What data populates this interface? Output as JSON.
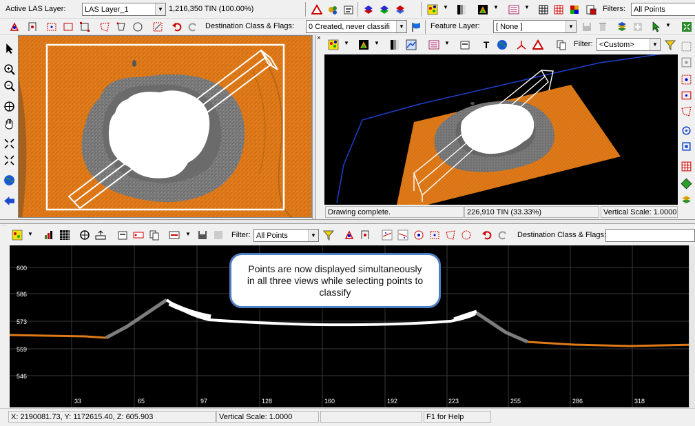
{
  "toolbar1": {
    "active_las_label": "Active LAS Layer:",
    "active_las_value": "LAS Layer_1",
    "tin_count": "1,216,350 TIN (100.00%)",
    "filters_label": "Filters:",
    "filters_value": "All Points"
  },
  "toolbar2": {
    "dest_label": "Destination Class & Flags:",
    "dest_value": "0  Created, never classifi",
    "feature_label": "Feature Layer:",
    "feature_value": "[ None ]"
  },
  "view3d": {
    "filter_label": "Filter:",
    "filter_value": "<Custom>",
    "status_message": "Drawing complete.",
    "tin_count": "226,910 TIN (33.33%)",
    "vertical_scale": "Vertical Scale: 1.0000"
  },
  "profile": {
    "filter_label": "Filter:",
    "filter_value": "All Points",
    "dest_label": "Destination Class & Flags:",
    "dest_value": "",
    "y_ticks": [
      "600",
      "586",
      "573",
      "559",
      "546"
    ],
    "x_ticks": [
      "33",
      "65",
      "97",
      "128",
      "160",
      "192",
      "223",
      "255",
      "286",
      "318"
    ],
    "callout_text": "Points are now displayed simultaneously in all three views while selecting points to classify"
  },
  "statusbar": {
    "coords": "X: 2190081.73, Y: 1172615.40, Z: 605.903",
    "vertical_scale": "Vertical Scale: 1.0000",
    "empty": "",
    "help": "F1 for Help"
  },
  "colors": {
    "terrain": "#e07a18",
    "crater": "#7d7d7d",
    "selection": "#ffffff",
    "boundary": "#1f3fd0",
    "accent": "#4f7fc4"
  },
  "icons": [
    "flag-triangle-icon",
    "filter-funnel-icon",
    "magnifier-icon",
    "hand-pan-icon",
    "globe-icon",
    "back-arrow-icon",
    "undo-icon",
    "redo-icon",
    "text-tool-icon",
    "pointer-icon"
  ]
}
